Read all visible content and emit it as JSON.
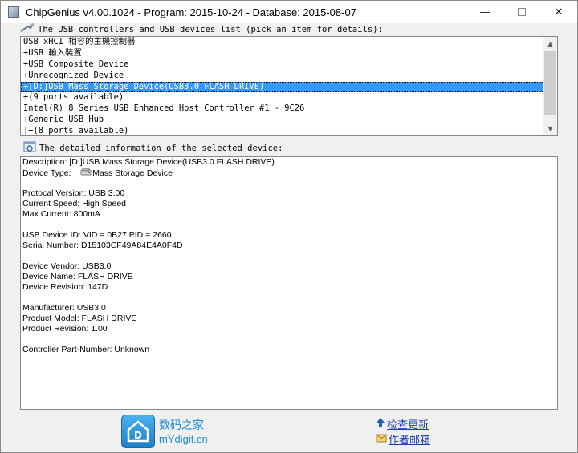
{
  "window": {
    "title": "ChipGenius v4.00.1024 - Program: 2015-10-24 - Database: 2015-08-07",
    "minimize_glyph": "—",
    "close_glyph": "✕"
  },
  "devices_section": {
    "label": "The USB controllers and USB devices list (pick an item for details):",
    "icon": "usb-cable-icon",
    "items": [
      {
        "label": "USB xHCI 相容的主機控制器",
        "selected": false
      },
      {
        "label": "+USB 輸入裝置",
        "selected": false
      },
      {
        "label": "+USB Composite Device",
        "selected": false
      },
      {
        "label": "+Unrecognized Device",
        "selected": false
      },
      {
        "label": "+[D:]USB Mass Storage Device(USB3.0 FLASH DRIVE)",
        "selected": true
      },
      {
        "label": "+(9 ports available)",
        "selected": false
      },
      {
        "label": "Intel(R) 8 Series USB Enhanced Host Controller #1 - 9C26",
        "selected": false
      },
      {
        "label": "+Generic USB Hub",
        "selected": false
      },
      {
        "label": "|+(8 ports available)",
        "selected": false
      }
    ]
  },
  "details_section": {
    "label": "The detailed information of the selected device:",
    "icon": "info-window-icon",
    "lines": {
      "description": "Description: [D:]USB Mass Storage Device(USB3.0 FLASH DRIVE)",
      "device_type_label": "Device Type:",
      "device_type_value": "Mass Storage Device",
      "protocol_version": "Protocal Version: USB 3.00",
      "current_speed": "Current Speed: High Speed",
      "max_current": "Max Current: 800mA",
      "usb_device_id": "USB Device ID: VID = 0B27 PID = 2660",
      "serial_number": "Serial Number: D15103CF49A84E4A0F4D",
      "device_vendor": "Device Vendor: USB3.0",
      "device_name": "Device Name: FLASH DRIVE",
      "device_revision": "Device Revision: 147D",
      "manufacturer": "Manufacturer: USB3.0",
      "product_model": "Product Model: FLASH DRIVE",
      "product_revision": "Product Revision: 1.00",
      "controller_part_number": "Controller Part-Number: Unknown"
    }
  },
  "footer": {
    "logo_cn": "数码之家",
    "logo_en": "mYdigit.cn",
    "logo_letter": "D",
    "check_update": "检查更新",
    "author_email": "作者邮箱"
  },
  "colors": {
    "selection": "#3399ff",
    "link": "#1a3fa8",
    "logo_blue": "#1f8ad2"
  }
}
